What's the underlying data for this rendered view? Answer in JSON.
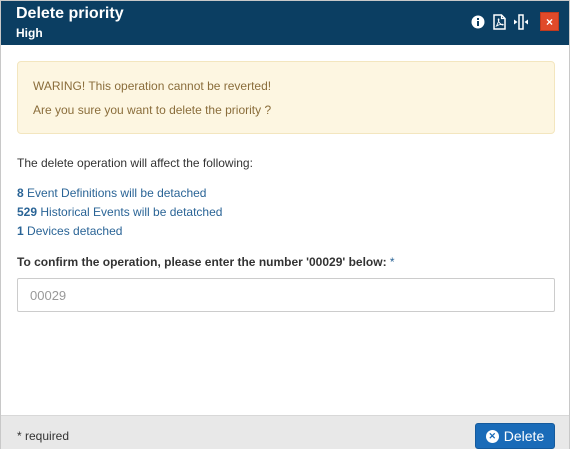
{
  "header": {
    "title": "Delete priority",
    "subtitle": "High",
    "close_label": "×"
  },
  "warning": {
    "line1": "WARING! This operation cannot be reverted!",
    "line2": "Are you sure you want to delete the priority ?"
  },
  "affect_intro": "The delete operation will affect the following:",
  "effects": [
    {
      "count": "8",
      "text": " Event Definitions will be detached"
    },
    {
      "count": "529",
      "text": " Historical Events will be detatched"
    },
    {
      "count": "1",
      "text": " Devices detached"
    }
  ],
  "confirm": {
    "label": "To confirm the operation, please enter the number '00029' below:",
    "required_mark": " *",
    "placeholder": "00029",
    "value": ""
  },
  "footer": {
    "required_note": "* required",
    "delete_label": "Delete"
  },
  "colors": {
    "titlebar": "#0b3e62",
    "close": "#e04a2a",
    "warning_bg": "#fdf6e1",
    "warning_text": "#8a6d3b",
    "link": "#2a6496",
    "primary": "#1a6bb8"
  },
  "icons": {
    "info": "info-circle-icon",
    "pdf": "pdf-file-icon",
    "resize": "resize-horizontal-icon",
    "close": "close-icon",
    "delete": "times-circle-icon"
  }
}
